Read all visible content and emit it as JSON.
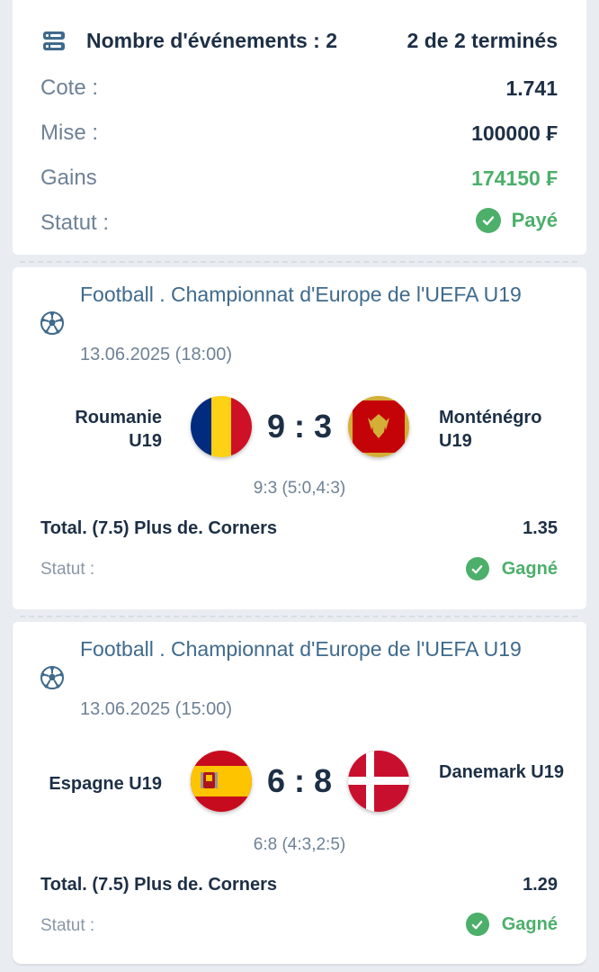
{
  "summary": {
    "events_label": "Nombre d'événements : 2",
    "completed": "2 de 2 terminés",
    "rows": [
      {
        "label": "Cote :",
        "value": "1.741"
      },
      {
        "label": "Mise :",
        "value": "100000 ₣"
      },
      {
        "label": "Gains",
        "value": "174150 ₣"
      }
    ],
    "status_label": "Statut :",
    "status_value": "Payé"
  },
  "events": [
    {
      "league": "Football . Championnat d'Europe de l'UEFA U19",
      "date": "13.06.2025 (18:00)",
      "home": "Roumanie U19",
      "away": "Monténégro U19",
      "score": "9 : 3",
      "detail": "9:3 (5:0,4:3)",
      "bet": "Total. (7.5) Plus de. Corners",
      "odd": "1.35",
      "status_label": "Statut :",
      "status": "Gagné"
    },
    {
      "league": "Football . Championnat d'Europe de l'UEFA U19",
      "date": "13.06.2025 (15:00)",
      "home": "Espagne U19",
      "away": "Danemark U19",
      "score": "6 : 8",
      "detail": "6:8 (4:3,2:5)",
      "bet": "Total. (7.5) Plus de. Corners",
      "odd": "1.29",
      "status_label": "Statut :",
      "status": "Gagné"
    }
  ],
  "colors": {
    "accent_green": "#4caf6a",
    "dark_text": "#1d2f45",
    "league_blue": "#3f6a8c",
    "muted": "#6f8196"
  },
  "icons": [
    "list-icon",
    "check-circle-icon",
    "soccer-ball-icon",
    "flag-romania-icon",
    "flag-montenegro-icon",
    "flag-spain-icon",
    "flag-denmark-icon"
  ]
}
